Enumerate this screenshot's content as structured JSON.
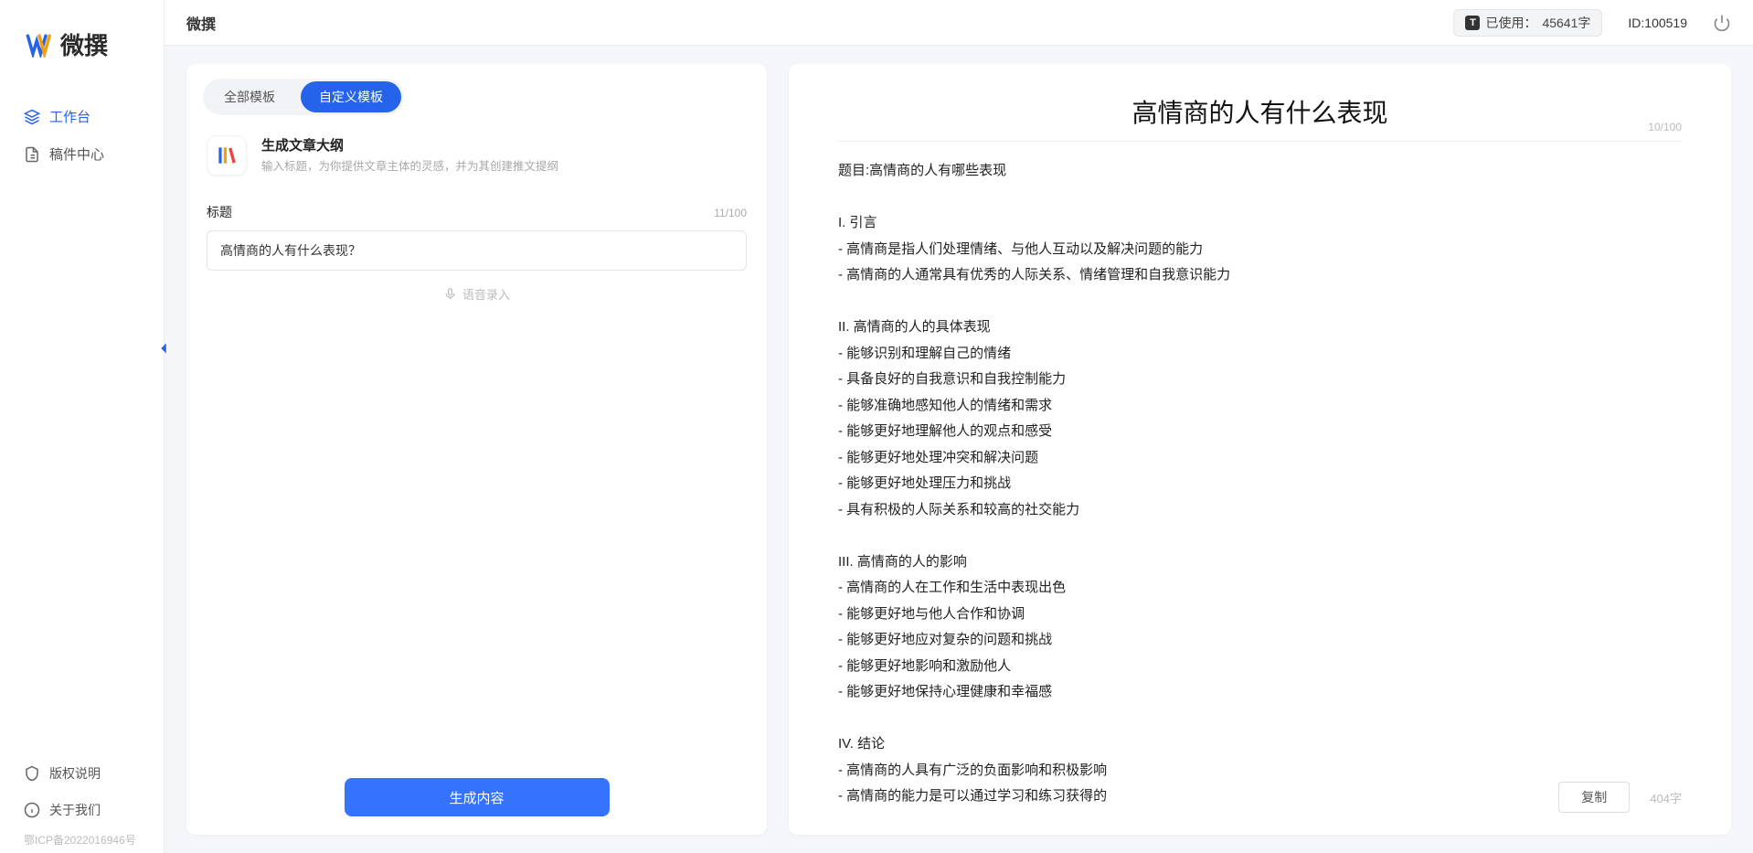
{
  "brand": {
    "name": "微撰"
  },
  "sidebar": {
    "nav": [
      {
        "label": "工作台",
        "active": true
      },
      {
        "label": "稿件中心",
        "active": false
      }
    ],
    "bottom": [
      {
        "label": "版权说明"
      },
      {
        "label": "关于我们"
      }
    ],
    "footer": "鄂ICP备2022016946号"
  },
  "topbar": {
    "usage_prefix": "已使用：",
    "usage_value": "45641字",
    "id_label": "ID:100519"
  },
  "left": {
    "tabs": [
      {
        "label": "全部模板",
        "active": false
      },
      {
        "label": "自定义模板",
        "active": true
      }
    ],
    "template": {
      "title": "生成文章大纲",
      "desc": "输入标题，为你提供文章主体的灵感，并为其创建推文提纲"
    },
    "form": {
      "title_label": "标题",
      "title_counter": "11/100",
      "title_value": "高情商的人有什么表现？",
      "voice_hint": "语音录入"
    },
    "generate_label": "生成内容"
  },
  "right": {
    "title": "高情商的人有什么表现",
    "title_counter": "10/100",
    "body": "题目:高情商的人有哪些表现\n\nI. 引言\n- 高情商是指人们处理情绪、与他人互动以及解决问题的能力\n- 高情商的人通常具有优秀的人际关系、情绪管理和自我意识能力\n\nII. 高情商的人的具体表现\n- 能够识别和理解自己的情绪\n- 具备良好的自我意识和自我控制能力\n- 能够准确地感知他人的情绪和需求\n- 能够更好地理解他人的观点和感受\n- 能够更好地处理冲突和解决问题\n- 能够更好地处理压力和挑战\n- 具有积极的人际关系和较高的社交能力\n\nIII. 高情商的人的影响\n- 高情商的人在工作和生活中表现出色\n- 能够更好地与他人合作和协调\n- 能够更好地应对复杂的问题和挑战\n- 能够更好地影响和激励他人\n- 能够更好地保持心理健康和幸福感\n\nIV. 结论\n- 高情商的人具有广泛的负面影响和积极影响\n- 高情商的能力是可以通过学习和练习获得的\n- 培养和提高高情商的能力对于个人的职业发展和生活质量至关重要。",
    "copy_label": "复制",
    "char_count": "404字"
  }
}
